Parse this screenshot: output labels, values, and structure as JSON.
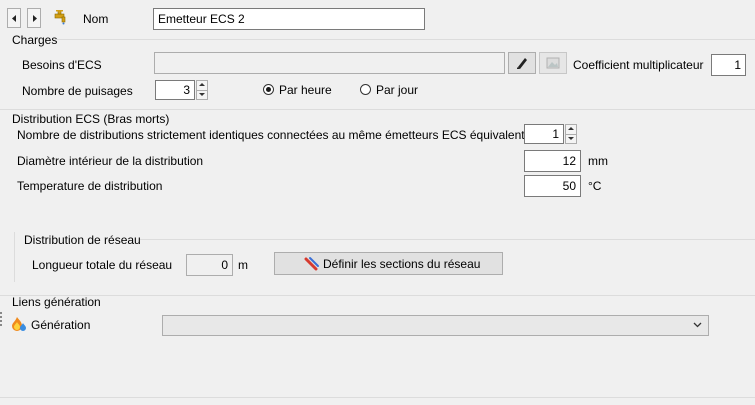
{
  "name": {
    "label": "Nom",
    "value": "Emetteur ECS 2"
  },
  "charges": {
    "title": "Charges",
    "besoins_label": "Besoins d'ECS",
    "coef_label": "Coefficient multiplicateur",
    "coef_value": "1",
    "puisages_label": "Nombre de puisages",
    "puisages_value": "3",
    "radio_heure": "Par heure",
    "radio_jour": "Par jour"
  },
  "distribution": {
    "title": "Distribution ECS (Bras morts)",
    "nb_label": "Nombre de distributions strictement identiques connectées au même émetteurs ECS équivalent",
    "nb_value": "1",
    "diam_label": "Diamètre intérieur de la distribution",
    "diam_value": "12",
    "diam_unit": "mm",
    "temp_label": "Temperature de distribution",
    "temp_value": "50",
    "temp_unit": "°C"
  },
  "reseau": {
    "title": "Distribution de réseau",
    "longueur_label": "Longueur totale du réseau",
    "longueur_value": "0",
    "longueur_unit": "m",
    "define_button": "Définir les sections du réseau"
  },
  "liens": {
    "title": "Liens génération",
    "generation_label": "Génération",
    "generation_value": ""
  },
  "colors": {
    "background": "#f0f0f0",
    "border": "#7a7a7a",
    "separator": "#dcdcdc"
  }
}
